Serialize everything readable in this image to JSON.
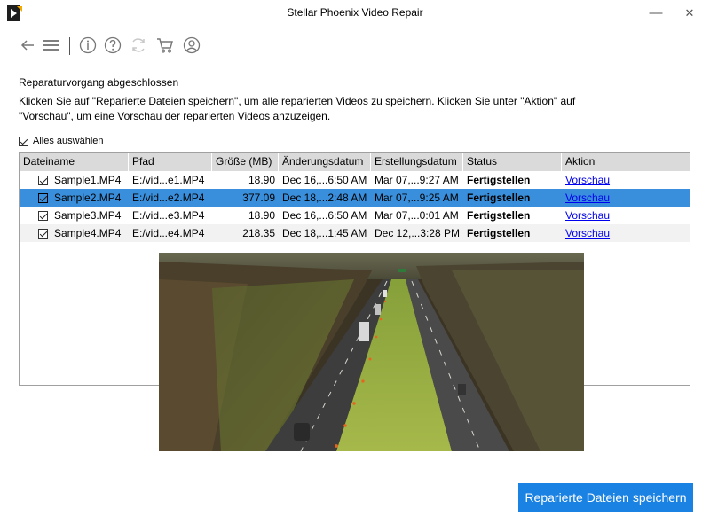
{
  "window": {
    "title": "Stellar Phoenix Video Repair",
    "minimize_glyph": "—",
    "close_glyph": "✕"
  },
  "toolbar": {
    "icons": [
      "back-arrow-icon",
      "menu-icon",
      "info-icon",
      "help-icon",
      "refresh-icon",
      "cart-icon",
      "user-account-icon"
    ]
  },
  "main": {
    "heading": "Reparaturvorgang abgeschlossen",
    "description": "Klicken Sie auf \"Reparierte Dateien speichern\", um alle reparierten Videos zu speichern. Klicken Sie unter \"Aktion\" auf \"Vorschau\", um eine Vorschau der reparierten Videos anzuzeigen.",
    "select_all_label": "Alles auswählen",
    "select_all_checked": true
  },
  "table": {
    "columns": [
      "Dateiname",
      "Pfad",
      "Größe (MB)",
      "Änderungsdatum",
      "Erstellungsdatum",
      "Status",
      "Aktion"
    ],
    "rows": [
      {
        "checked": true,
        "name": "Sample1.MP4",
        "path": "E:/vid...e1.MP4",
        "size": "18.90",
        "modified": "Dec 16,...6:50 AM",
        "created": "Mar 07,...9:27 AM",
        "status": "Fertigstellen",
        "action": "Vorschau",
        "selected": false
      },
      {
        "checked": true,
        "name": "Sample2.MP4",
        "path": "E:/vid...e2.MP4",
        "size": "377.09",
        "modified": "Dec 18,...2:48 AM",
        "created": "Mar 07,...9:25 AM",
        "status": "Fertigstellen",
        "action": "Vorschau",
        "selected": true
      },
      {
        "checked": true,
        "name": "Sample3.MP4",
        "path": "E:/vid...e3.MP4",
        "size": "18.90",
        "modified": "Dec 16,...6:50 AM",
        "created": "Mar 07,...0:01 AM",
        "status": "Fertigstellen",
        "action": "Vorschau",
        "selected": false
      },
      {
        "checked": true,
        "name": "Sample4.MP4",
        "path": "E:/vid...e4.MP4",
        "size": "218.35",
        "modified": "Dec 18,...1:45 AM",
        "created": "Dec 12,...3:28 PM",
        "status": "Fertigstellen",
        "action": "Vorschau",
        "selected": false
      }
    ]
  },
  "footer": {
    "save_label": "Reparierte Dateien speichern"
  },
  "colors": {
    "accent": "#1a82e2",
    "selected_row": "#3a8fdc",
    "link": "#0000ee"
  }
}
